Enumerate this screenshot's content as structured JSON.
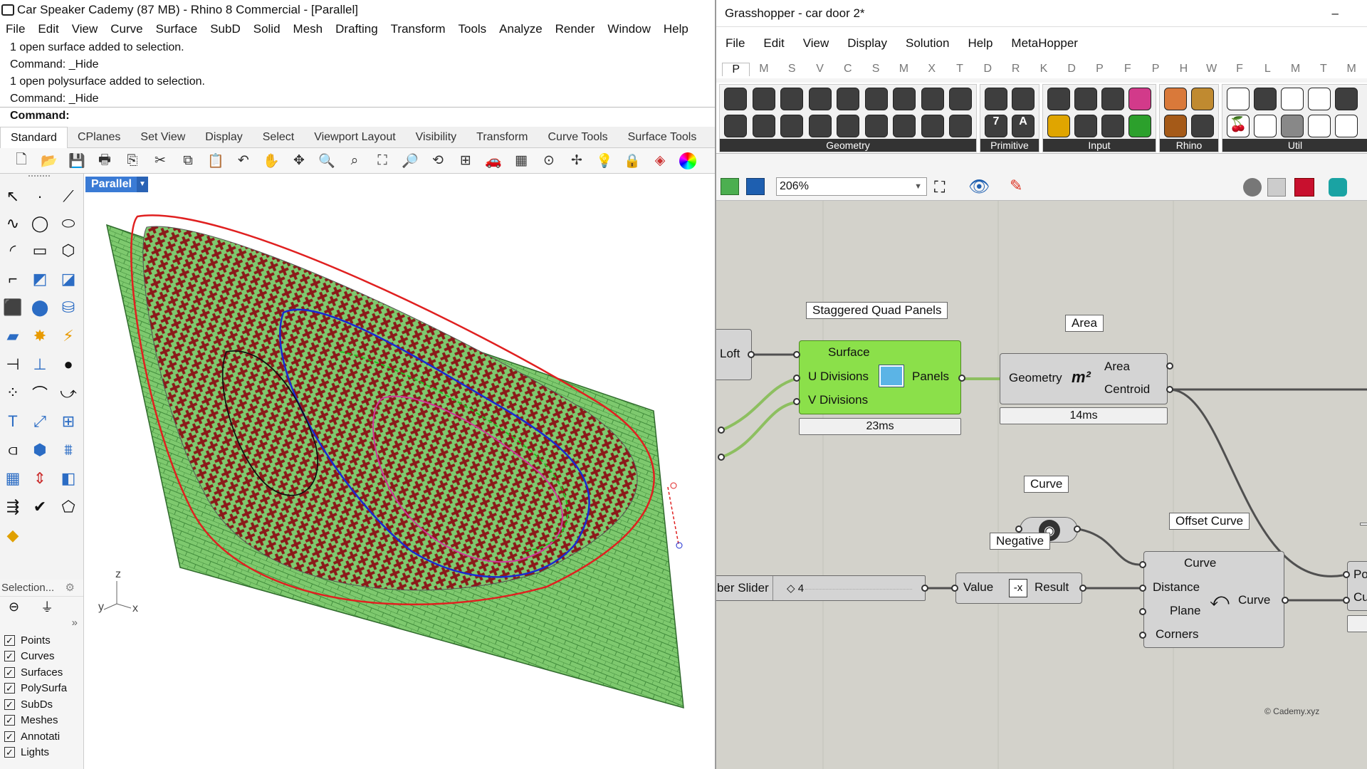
{
  "rhino": {
    "title": "Car Speaker Cademy (87 MB) - Rhino 8 Commercial - [Parallel]",
    "menu": [
      "File",
      "Edit",
      "View",
      "Curve",
      "Surface",
      "SubD",
      "Solid",
      "Mesh",
      "Drafting",
      "Transform",
      "Tools",
      "Analyze",
      "Render",
      "Window",
      "Help"
    ],
    "history": [
      "1 open surface added to selection.",
      "Command: _Hide",
      "1 open polysurface added to selection.",
      "Command: _Hide"
    ],
    "command_label": "Command:",
    "tabs": [
      "Standard",
      "CPlanes",
      "Set View",
      "Display",
      "Select",
      "Viewport Layout",
      "Visibility",
      "Transform",
      "Curve Tools",
      "Surface Tools"
    ],
    "viewport_label": "Parallel",
    "selection_label": "Selection...",
    "filters": [
      "Points",
      "Curves",
      "Surfaces",
      "PolySurfa",
      "SubDs",
      "Meshes",
      "Annotati",
      "Lights"
    ],
    "axes": {
      "z": "z",
      "y": "y",
      "x": "x"
    }
  },
  "gh": {
    "title": "Grasshopper - car door 2*",
    "menu": [
      "File",
      "Edit",
      "View",
      "Display",
      "Solution",
      "Help",
      "MetaHopper"
    ],
    "tabs": [
      "P",
      "M",
      "S",
      "V",
      "C",
      "S",
      "M",
      "X",
      "T",
      "D",
      "R",
      "K",
      "D",
      "P",
      "F",
      "P",
      "H",
      "W",
      "F",
      "L",
      "M",
      "T",
      "M"
    ],
    "groups": [
      "Geometry",
      "Primitive",
      "Input",
      "Rhino",
      "Util"
    ],
    "zoom": "206%",
    "loft": "Loft",
    "sqp": {
      "bubble": "Staggered Quad Panels",
      "in": [
        "Surface",
        "U Divisions",
        "V Divisions"
      ],
      "out": "Panels",
      "time": "23ms"
    },
    "area": {
      "bubble": "Area",
      "in": "Geometry",
      "symbol": "m²",
      "out": [
        "Area",
        "Centroid"
      ],
      "time": "14ms"
    },
    "curve": {
      "bubble": "Curve"
    },
    "negative": {
      "bubble": "Negative",
      "in": "Value",
      "out": "Result"
    },
    "slider": {
      "label": "ber Slider",
      "value": "◇ 4"
    },
    "offset": {
      "bubble": "Offset Curve",
      "in": [
        "Curve",
        "Distance",
        "Plane",
        "Corners"
      ],
      "out": "Curve"
    },
    "edge": {
      "a": "Po",
      "b": "Cu"
    },
    "credit": "© Cademy.xyz"
  }
}
